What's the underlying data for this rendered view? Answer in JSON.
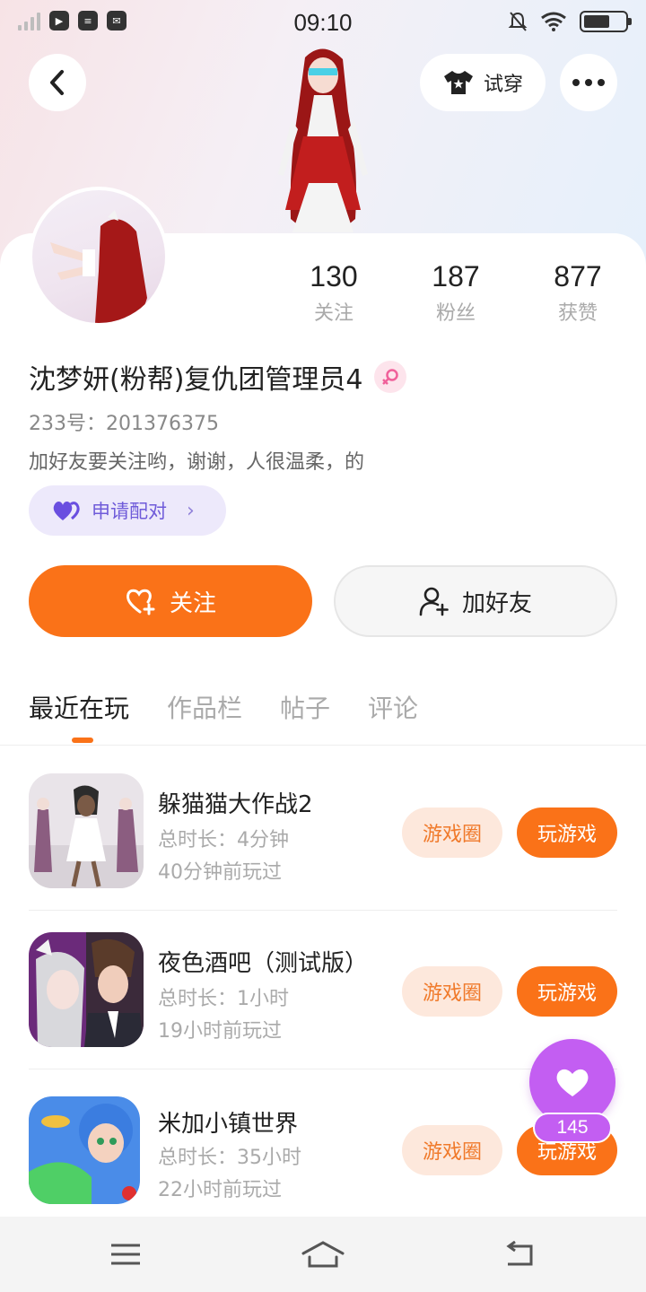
{
  "status": {
    "time": "09:10"
  },
  "header": {
    "try_on_label": "试穿"
  },
  "profile": {
    "name": "沈梦妍(粉帮)复仇团管理员4",
    "uid": "233号：201376375",
    "bio": "加好友要关注哟，谢谢，人很温柔，的",
    "gender": "female"
  },
  "stats": [
    {
      "value": "130",
      "label": "关注"
    },
    {
      "value": "187",
      "label": "粉丝"
    },
    {
      "value": "877",
      "label": "获赞"
    }
  ],
  "pair": {
    "label": "申请配对"
  },
  "actions": {
    "follow_label": "关注",
    "add_friend_label": "加好友"
  },
  "tabs": [
    "最近在玩",
    "作品栏",
    "帖子",
    "评论"
  ],
  "games": [
    {
      "name": "躲猫猫大作战2",
      "duration": "总时长：4分钟",
      "last_played": "40分钟前玩过",
      "circle_label": "游戏圈",
      "play_label": "玩游戏"
    },
    {
      "name": "夜色酒吧（测试版）",
      "duration": "总时长：1小时",
      "last_played": "19小时前玩过",
      "circle_label": "游戏圈",
      "play_label": "玩游戏"
    },
    {
      "name": "米加小镇世界",
      "duration": "总时长：35小时",
      "last_played": "22小时前玩过",
      "circle_label": "游戏圈",
      "play_label": "玩游戏"
    }
  ],
  "like_float": {
    "count": "145"
  },
  "colors": {
    "accent": "#fa7218",
    "like": "#c35ef2",
    "pair": "#6f5bd9"
  }
}
